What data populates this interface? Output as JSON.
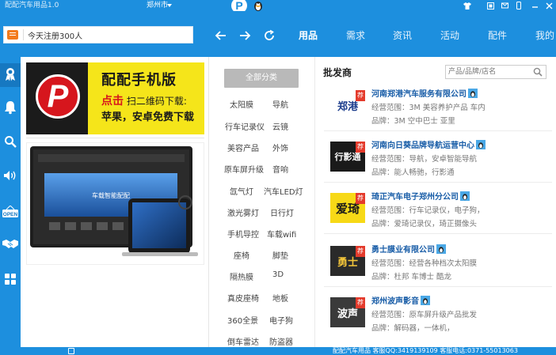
{
  "titlebar": {
    "app_title": "配配汽车用品1.0",
    "city": "郑州市",
    "logo_letter": "P"
  },
  "search": {
    "value": "今天注册300人",
    "placeholder": "今天注册300人"
  },
  "nav": {
    "tabs": [
      {
        "label": "用品",
        "active": true
      },
      {
        "label": "需求",
        "active": false
      },
      {
        "label": "资讯",
        "active": false
      },
      {
        "label": "活动",
        "active": false
      },
      {
        "label": "配件",
        "active": false
      },
      {
        "label": "我的",
        "active": false
      }
    ]
  },
  "sidebar": {
    "items": [
      {
        "icon": "award-icon"
      },
      {
        "icon": "bell-icon"
      },
      {
        "icon": "search-icon"
      },
      {
        "icon": "speaker-icon"
      },
      {
        "icon": "open-sign-icon",
        "label": "OPEN"
      },
      {
        "icon": "handshake-icon"
      },
      {
        "icon": "grid-icon"
      }
    ]
  },
  "ad": {
    "logo_letter": "P",
    "title": "配配手机版",
    "click": "点击",
    "line1": "扫二维码下载:",
    "line2": "苹果，安卓免费下载",
    "device_screen_text": "车载智能配配"
  },
  "categories": {
    "all_label": "全部分类",
    "items": [
      "太阳膜",
      "导航",
      "行车记录仪",
      "云镜",
      "美容产品",
      "外饰",
      "原车屏升级",
      "音响",
      "氙气灯",
      "汽车LED灯",
      "激光雾灯",
      "日行灯",
      "手机导控",
      "车载wifi",
      "座椅",
      "脚垫",
      "隔热膜",
      "3D",
      "真皮座椅",
      "地板",
      "360全景",
      "电子狗",
      "倒车雷达",
      "防盗器"
    ]
  },
  "vendors": {
    "title": "批发商",
    "search_placeholder": "产品/品牌/店名",
    "rec_label": "荐",
    "scope_label": "经营范围：",
    "brand_label": "品牌：",
    "list": [
      {
        "name": "河南郑港汽车服务有限公司",
        "scope": "3M 美容养护产品 车内",
        "brand": "3M 空中巴士 亚里",
        "logo_text": "郑港",
        "logo_bg": "#ffffff",
        "logo_fg": "#1b3c8c"
      },
      {
        "name": "河南向日葵品牌导航运营中心",
        "scope": "导航，安卓智能导航",
        "brand": "能人畅驰，行影通",
        "logo_text": "行影通",
        "logo_bg": "#1a1a1a",
        "logo_fg": "#ffffff"
      },
      {
        "name": "琦正汽车电子郑州分公司",
        "scope": "行车记录仪，电子狗，",
        "brand": "爱琦记录仪，琦正摄像头",
        "logo_text": "爱琦",
        "logo_bg": "#f7d917",
        "logo_fg": "#1a1a1a"
      },
      {
        "name": "勇士膜业有限公司",
        "scope": "经营各种档次太阳膜",
        "brand": "杜邦 车博士 酷龙",
        "logo_text": "勇士",
        "logo_bg": "#2a2a2a",
        "logo_fg": "#f3c53a"
      },
      {
        "name": "郑州波声影音",
        "scope": "原车屏升级产品批发",
        "brand": "解码器，一体机，",
        "logo_text": "波声",
        "logo_bg": "#3a3a3a",
        "logo_fg": "#ffffff"
      }
    ]
  },
  "status": {
    "text": "配配汽车用品 客服QQ:3419139109 客服电话:0371-55013063"
  },
  "colors": {
    "primary": "#1d8fde",
    "accent": "#f37b1d",
    "vendor_name": "#1a5ea8",
    "recommend": "#e43b2c"
  }
}
